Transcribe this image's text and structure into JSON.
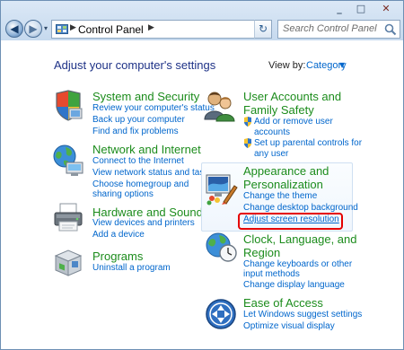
{
  "window": {
    "minimize": "_",
    "maximize": "□",
    "close": "✕"
  },
  "nav": {
    "back": "◀",
    "forward": "▶",
    "dropdown": "▾",
    "refresh": "↻"
  },
  "address": {
    "crumb": "Control Panel",
    "sep": "▶",
    "dropdown": "▾"
  },
  "search": {
    "placeholder": "Search Control Panel"
  },
  "heading": "Adjust your computer's settings",
  "view_by": {
    "label": "View by:",
    "value": "Category",
    "caret": "▼"
  },
  "categories": [
    {
      "title": "System and Security",
      "icon": "security-shield-icon",
      "links": [
        "Review your computer's status",
        "Back up your computer",
        "Find and fix problems"
      ]
    },
    {
      "title": "Network and Internet",
      "icon": "globe-network-icon",
      "links": [
        "Connect to the Internet",
        "View network status and tasks",
        "Choose homegroup and",
        "sharing options"
      ]
    },
    {
      "title": "Hardware and Sound",
      "icon": "printer-icon",
      "links": [
        "View devices and printers",
        "Add a device"
      ]
    },
    {
      "title": "Programs",
      "icon": "programs-box-icon",
      "links": [
        "Uninstall a program"
      ]
    },
    {
      "title": "User Accounts and",
      "title2": "Family Safety",
      "icon": "users-icon",
      "links": [
        "Add or remove user",
        "accounts",
        "Set up parental controls for",
        "any user"
      ]
    },
    {
      "title": "Appearance and",
      "title2": "Personalization",
      "icon": "appearance-monitor-icon",
      "links": [
        "Change the theme",
        "Change desktop background",
        "Adjust screen resolution"
      ]
    },
    {
      "title": "Clock, Language, and",
      "title2": "Region",
      "icon": "clock-globe-icon",
      "links": [
        "Change keyboards or other",
        "input methods",
        "Change display language"
      ]
    },
    {
      "title": "Ease of Access",
      "icon": "ease-of-access-icon",
      "links": [
        "Let Windows suggest settings",
        "Optimize visual display"
      ]
    }
  ],
  "colors": {
    "title_green": "#1c8c1c",
    "link_blue": "#0066cc",
    "heading_navy": "#1e3287",
    "highlight_red": "#e50000"
  }
}
